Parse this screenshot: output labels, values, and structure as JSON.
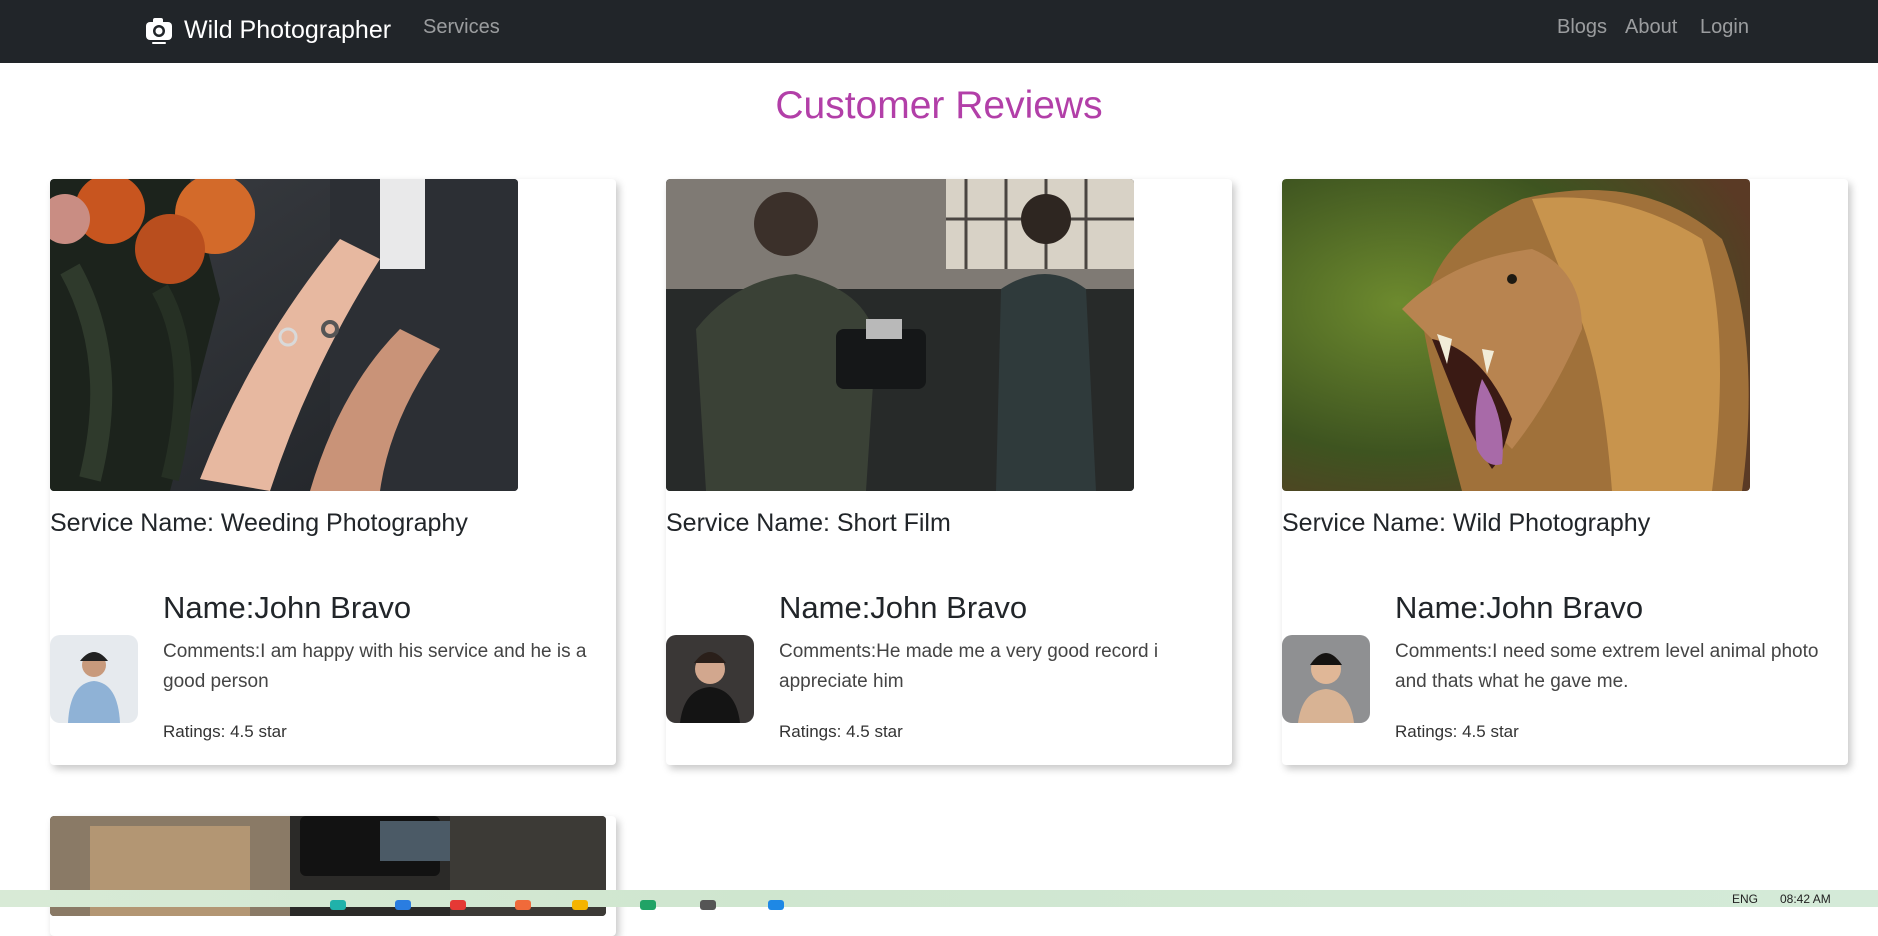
{
  "navbar": {
    "brand": "Wild Photographer",
    "links_left": [
      "Services"
    ],
    "links_right": [
      "Blogs",
      "About",
      "Login"
    ]
  },
  "page": {
    "title": "Customer Reviews"
  },
  "reviews": [
    {
      "service": "Service Name: Weeding Photography",
      "name": "Name:John Bravo",
      "comment": "Comments:I am happy with his service and he is a good person",
      "rating": "Ratings: 4.5 star"
    },
    {
      "service": "Service Name: Short Film",
      "name": "Name:John Bravo",
      "comment": "Comments:He made me a very good record i appreciate him",
      "rating": "Ratings: 4.5 star"
    },
    {
      "service": "Service Name: Wild Photography",
      "name": "Name:John Bravo",
      "comment": "Comments:I need some extrem level animal photo and thats what he gave me.",
      "rating": "Ratings: 4.5 star"
    }
  ],
  "taskbar": {
    "language": "ENG",
    "time": "08:42 AM"
  },
  "colors": {
    "navbar": "#212529",
    "title": "#b23fa8"
  }
}
